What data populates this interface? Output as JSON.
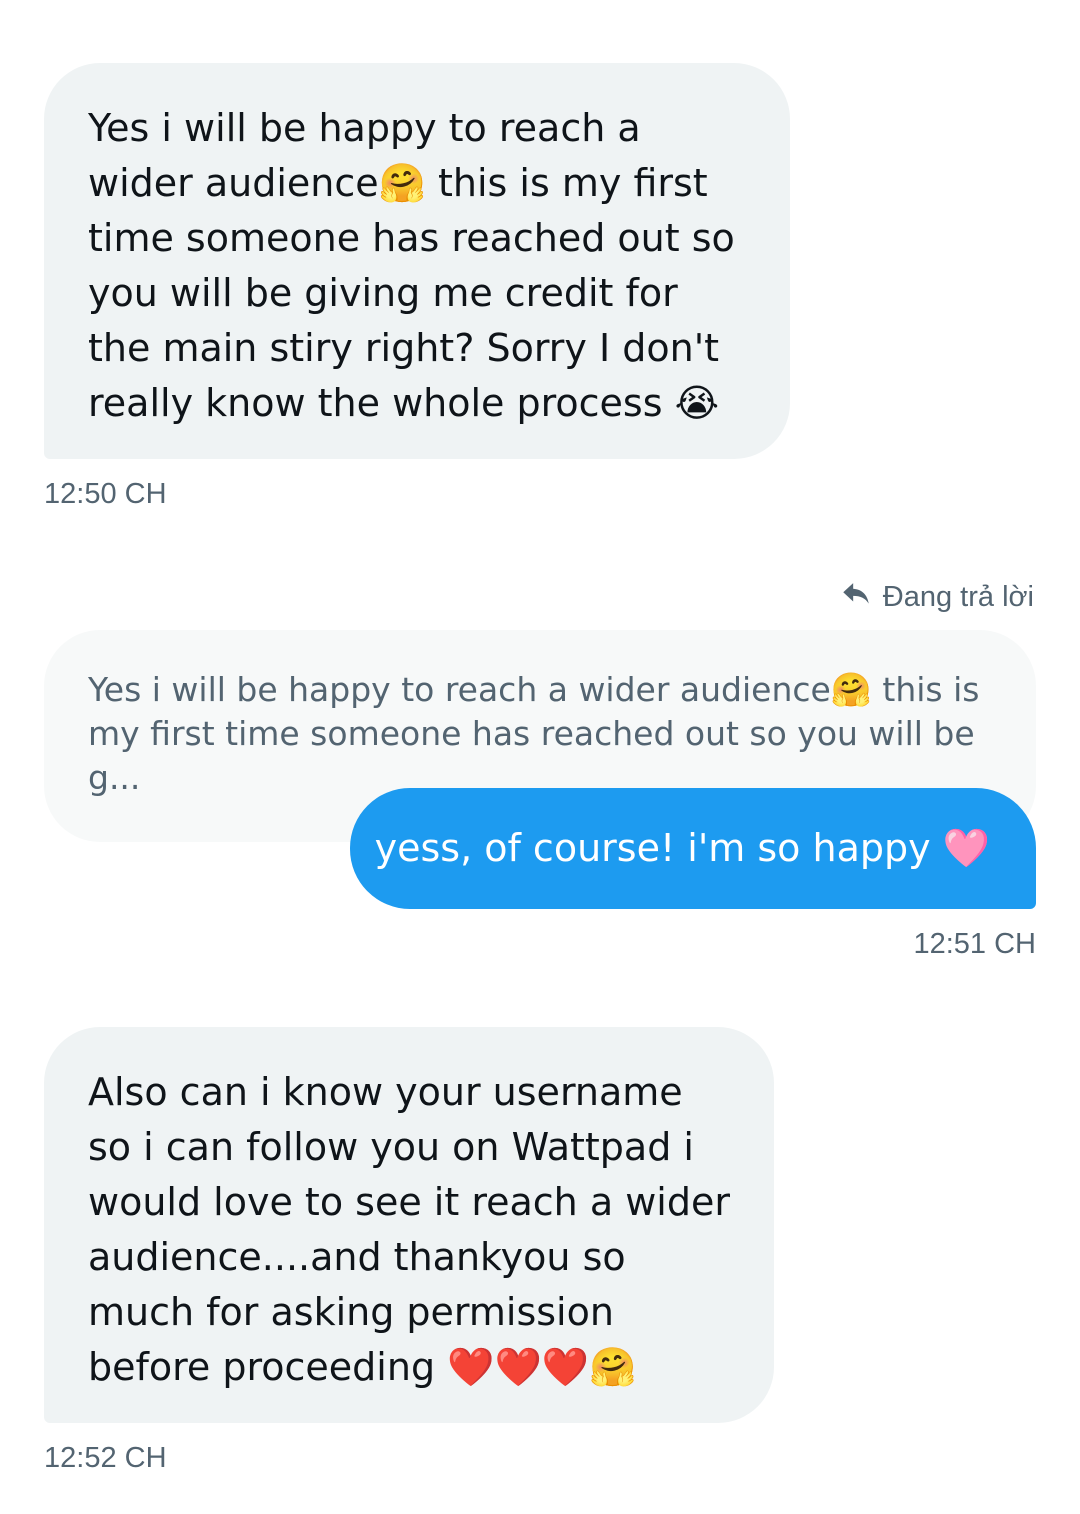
{
  "messages": [
    {
      "text": "Yes i will be happy to reach a wider audience🤗 this is my first time someone has reached out so you will be giving me credit for the main stiry right? Sorry I don't really know the whole process 😭",
      "time": "12:50 CH"
    },
    {
      "reply_indicator": "Đang trả lời",
      "quoted_text": "Yes i will be happy to reach a wider audience🤗 this is my first time someone has reached out so you will be g...",
      "text": "yess, of course! i'm so happy 🩷",
      "time": "12:51 CH"
    },
    {
      "text": "Also can i know your username so i can follow you on Wattpad i would love to see it reach a wider audience....and thankyou so much for asking permission before proceeding ❤️❤️❤️🤗",
      "time": "12:52 CH"
    }
  ],
  "colors": {
    "incoming_bubble": "#eff3f4",
    "outgoing_bubble": "#1d9bf0",
    "quote_bubble": "#f7f9f9",
    "timestamp": "#536471"
  },
  "icons": {
    "reply": "reply-arrow-icon"
  }
}
